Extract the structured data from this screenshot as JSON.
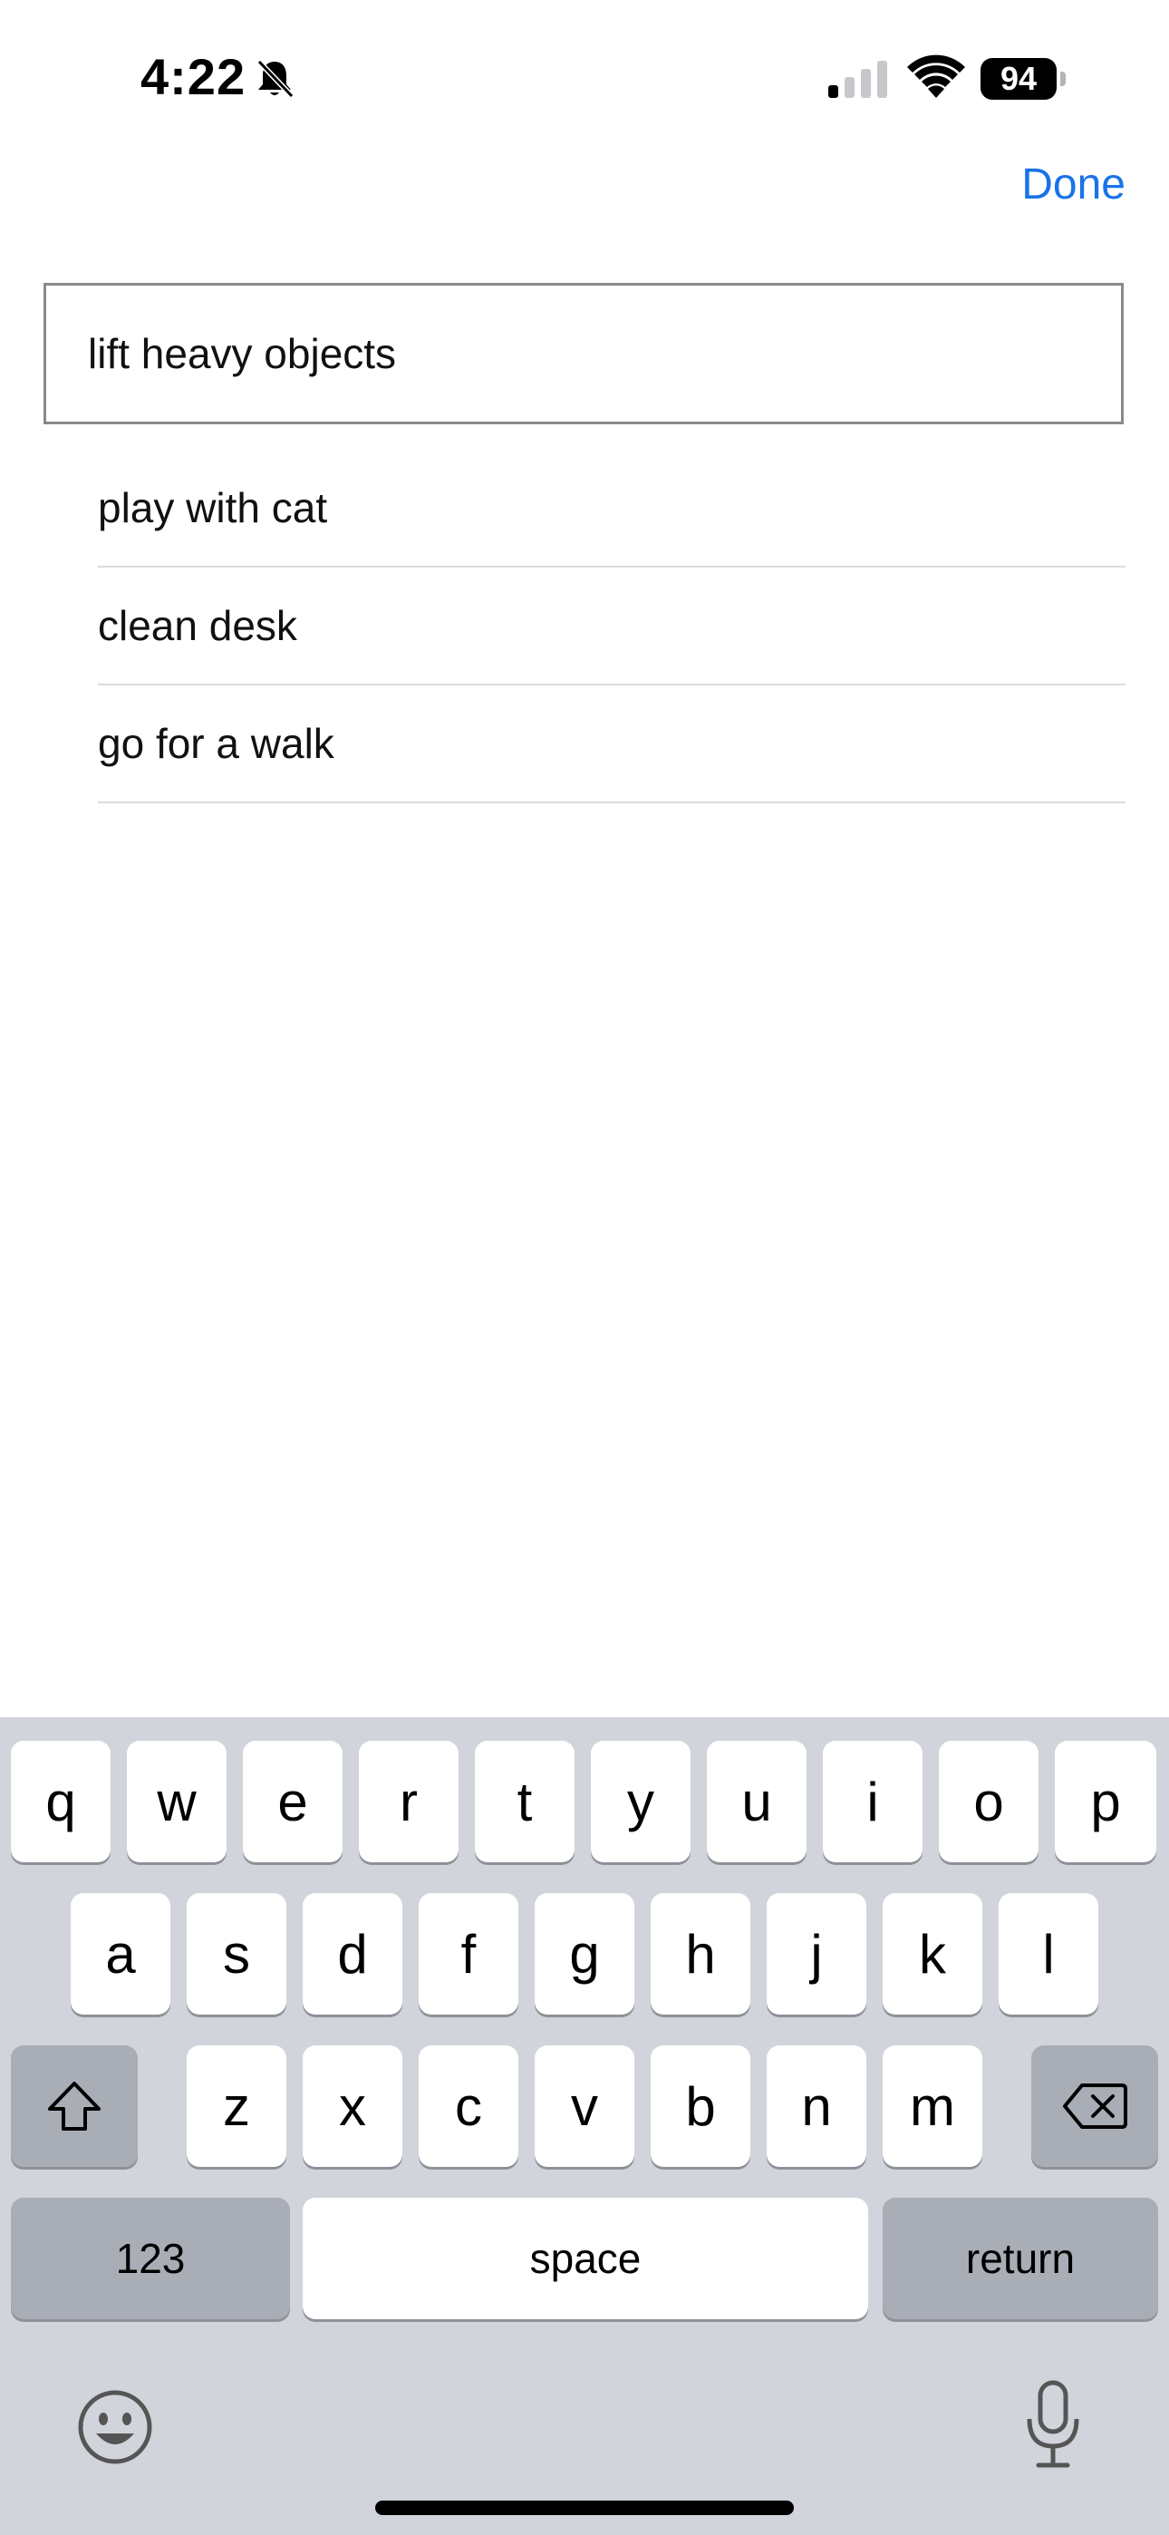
{
  "status_bar": {
    "time": "4:22",
    "battery": "94"
  },
  "header": {
    "done_label": "Done"
  },
  "input": {
    "value": "lift heavy objects",
    "placeholder": ""
  },
  "suggestions": [
    {
      "label": "play with cat"
    },
    {
      "label": "clean desk"
    },
    {
      "label": "go for a walk"
    }
  ],
  "keyboard": {
    "row1": [
      "q",
      "w",
      "e",
      "r",
      "t",
      "y",
      "u",
      "i",
      "o",
      "p"
    ],
    "row2": [
      "a",
      "s",
      "d",
      "f",
      "g",
      "h",
      "j",
      "k",
      "l"
    ],
    "row3": [
      "z",
      "x",
      "c",
      "v",
      "b",
      "n",
      "m"
    ],
    "numbers_label": "123",
    "space_label": "space",
    "return_label": "return"
  },
  "icons": {
    "bell": "bell-slash-icon",
    "signal": "cellular-signal-icon",
    "wifi": "wifi-icon",
    "shift": "shift-icon",
    "delete": "delete-backspace-icon",
    "emoji": "emoji-icon",
    "mic": "microphone-icon"
  },
  "colors": {
    "accent": "#1a73e8",
    "keyboard_bg": "#d1d4db",
    "dark_key": "#a9adb6"
  }
}
